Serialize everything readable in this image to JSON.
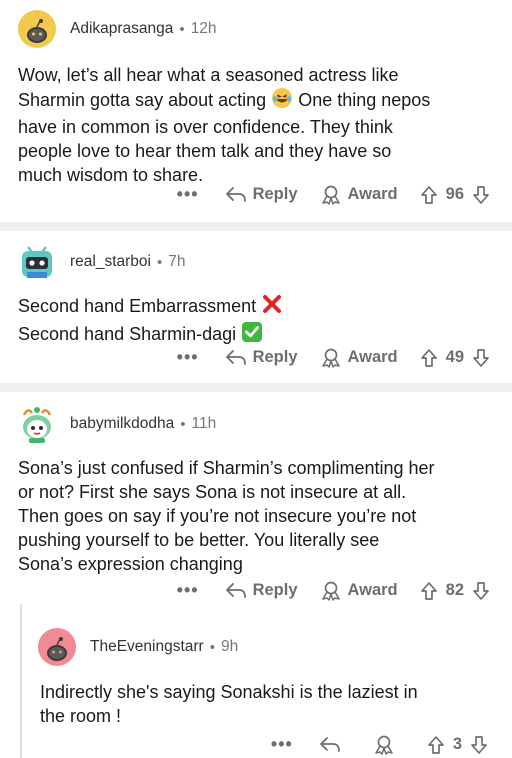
{
  "comments": [
    {
      "username": "Adikaprasanga",
      "age": "12h",
      "lines": [
        "Wow, let’s all hear what a seasoned actress like",
        "Sharmin gotta say about acting",
        "have in common is over confidence. They think",
        "people love to hear them talk and they have so",
        "much wisdom to share."
      ],
      "line2_tail": "One thing nepos",
      "reply_label": "Reply",
      "award_label": "Award",
      "votes": "96"
    },
    {
      "username": "real_starboi",
      "age": "7h",
      "lines": [
        "Second hand Embarrassment",
        "Second hand Sharmin-dagi"
      ],
      "reply_label": "Reply",
      "award_label": "Award",
      "votes": "49"
    },
    {
      "username": "babymilkdodha",
      "age": "11h",
      "lines": [
        "Sona’s just confused if Sharmin’s complimenting her",
        "or not? First she says Sona is not insecure at all.",
        "Then goes on say if you’re not insecure you’re not",
        "pushing yourself to be better. You literally see",
        "Sona’s expression changing"
      ],
      "reply_label": "Reply",
      "award_label": "Award",
      "votes": "82"
    },
    {
      "username": "TheEveningstarr",
      "age": "9h",
      "lines": [
        "Indirectly she's saying Sonakshi is the laziest in",
        "the room !"
      ],
      "votes": "3"
    }
  ],
  "colors": {
    "separator": "#edeff1",
    "meta_text": "#777777",
    "action_text": "#6b6f73",
    "avatar1": "#f2c94c",
    "avatar4": "#f28a94"
  },
  "icons": {
    "more": "more-icon",
    "reply": "reply-icon",
    "award": "award-icon",
    "upvote": "upvote-icon",
    "downvote": "downvote-icon"
  }
}
